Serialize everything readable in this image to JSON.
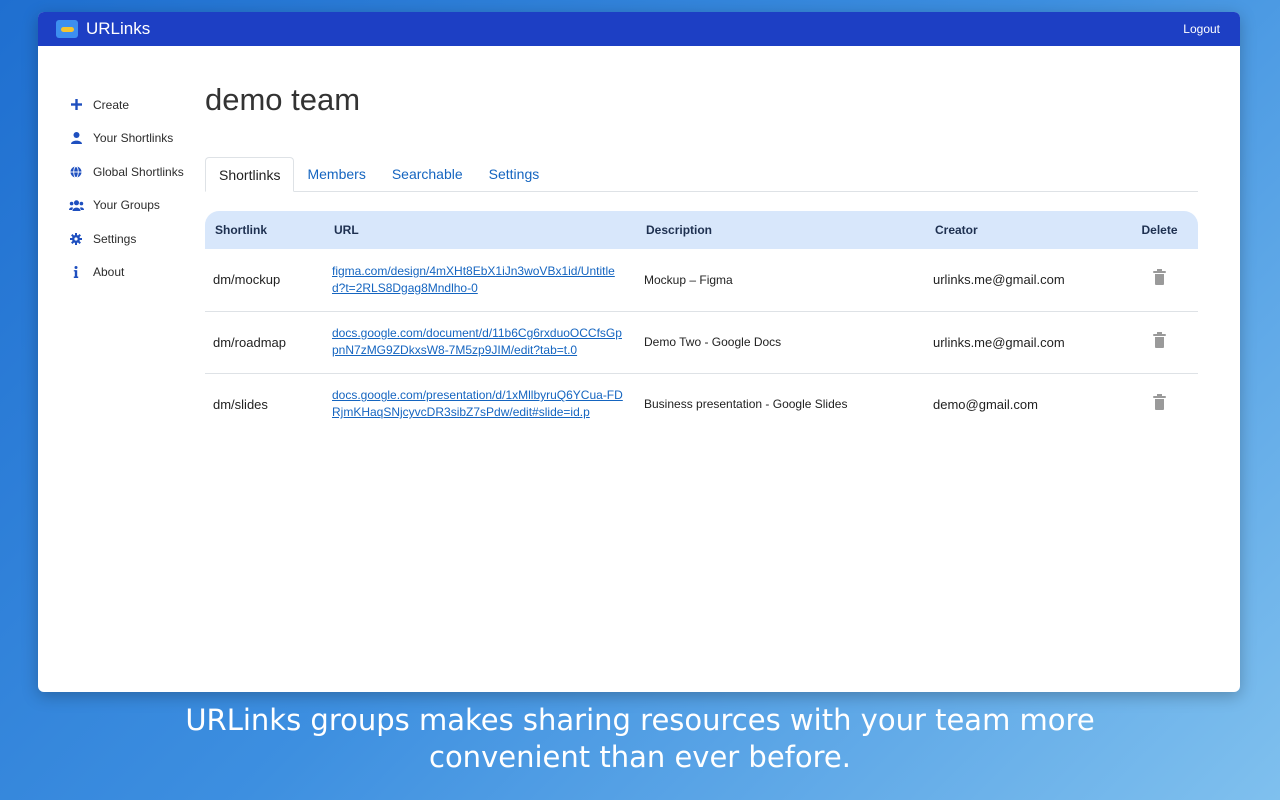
{
  "app": {
    "name": "URLinks",
    "logout_label": "Logout"
  },
  "sidebar": {
    "items": [
      {
        "label": "Create",
        "icon": "plus-icon"
      },
      {
        "label": "Your Shortlinks",
        "icon": "user-icon"
      },
      {
        "label": "Global Shortlinks",
        "icon": "globe-icon"
      },
      {
        "label": "Your Groups",
        "icon": "users-icon"
      },
      {
        "label": "Settings",
        "icon": "gear-icon"
      },
      {
        "label": "About",
        "icon": "info-icon"
      }
    ]
  },
  "page": {
    "title": "demo team"
  },
  "tabs": [
    {
      "label": "Shortlinks",
      "active": true
    },
    {
      "label": "Members",
      "active": false
    },
    {
      "label": "Searchable",
      "active": false
    },
    {
      "label": "Settings",
      "active": false
    }
  ],
  "table": {
    "headers": [
      "Shortlink",
      "URL",
      "Description",
      "Creator",
      "Delete"
    ],
    "rows": [
      {
        "shortlink": "dm/mockup",
        "url": "figma.com/design/4mXHt8EbX1iJn3woVBx1id/Untitled?t=2RLS8Dgag8Mndlho-0",
        "description": "Mockup – Figma",
        "creator": "urlinks.me@gmail.com"
      },
      {
        "shortlink": "dm/roadmap",
        "url": "docs.google.com/document/d/11b6Cg6rxduoOCCfsGppnN7zMG9ZDkxsW8-7M5zp9JIM/edit?tab=t.0",
        "description": "Demo Two - Google Docs",
        "creator": "urlinks.me@gmail.com"
      },
      {
        "shortlink": "dm/slides",
        "url": "docs.google.com/presentation/d/1xMllbyruQ6YCua-FDRjmKHaqSNjcyvcDR3sibZ7sPdw/edit#slide=id.p",
        "description": "Business presentation - Google Slides",
        "creator": "demo@gmail.com"
      }
    ]
  },
  "caption": {
    "line1": "URLinks groups makes sharing resources with your team more",
    "line2": "convenient than ever before."
  },
  "colors": {
    "topbar": "#1d3fc4",
    "accent": "#1565c0",
    "table_header": "#d8e7fb"
  }
}
